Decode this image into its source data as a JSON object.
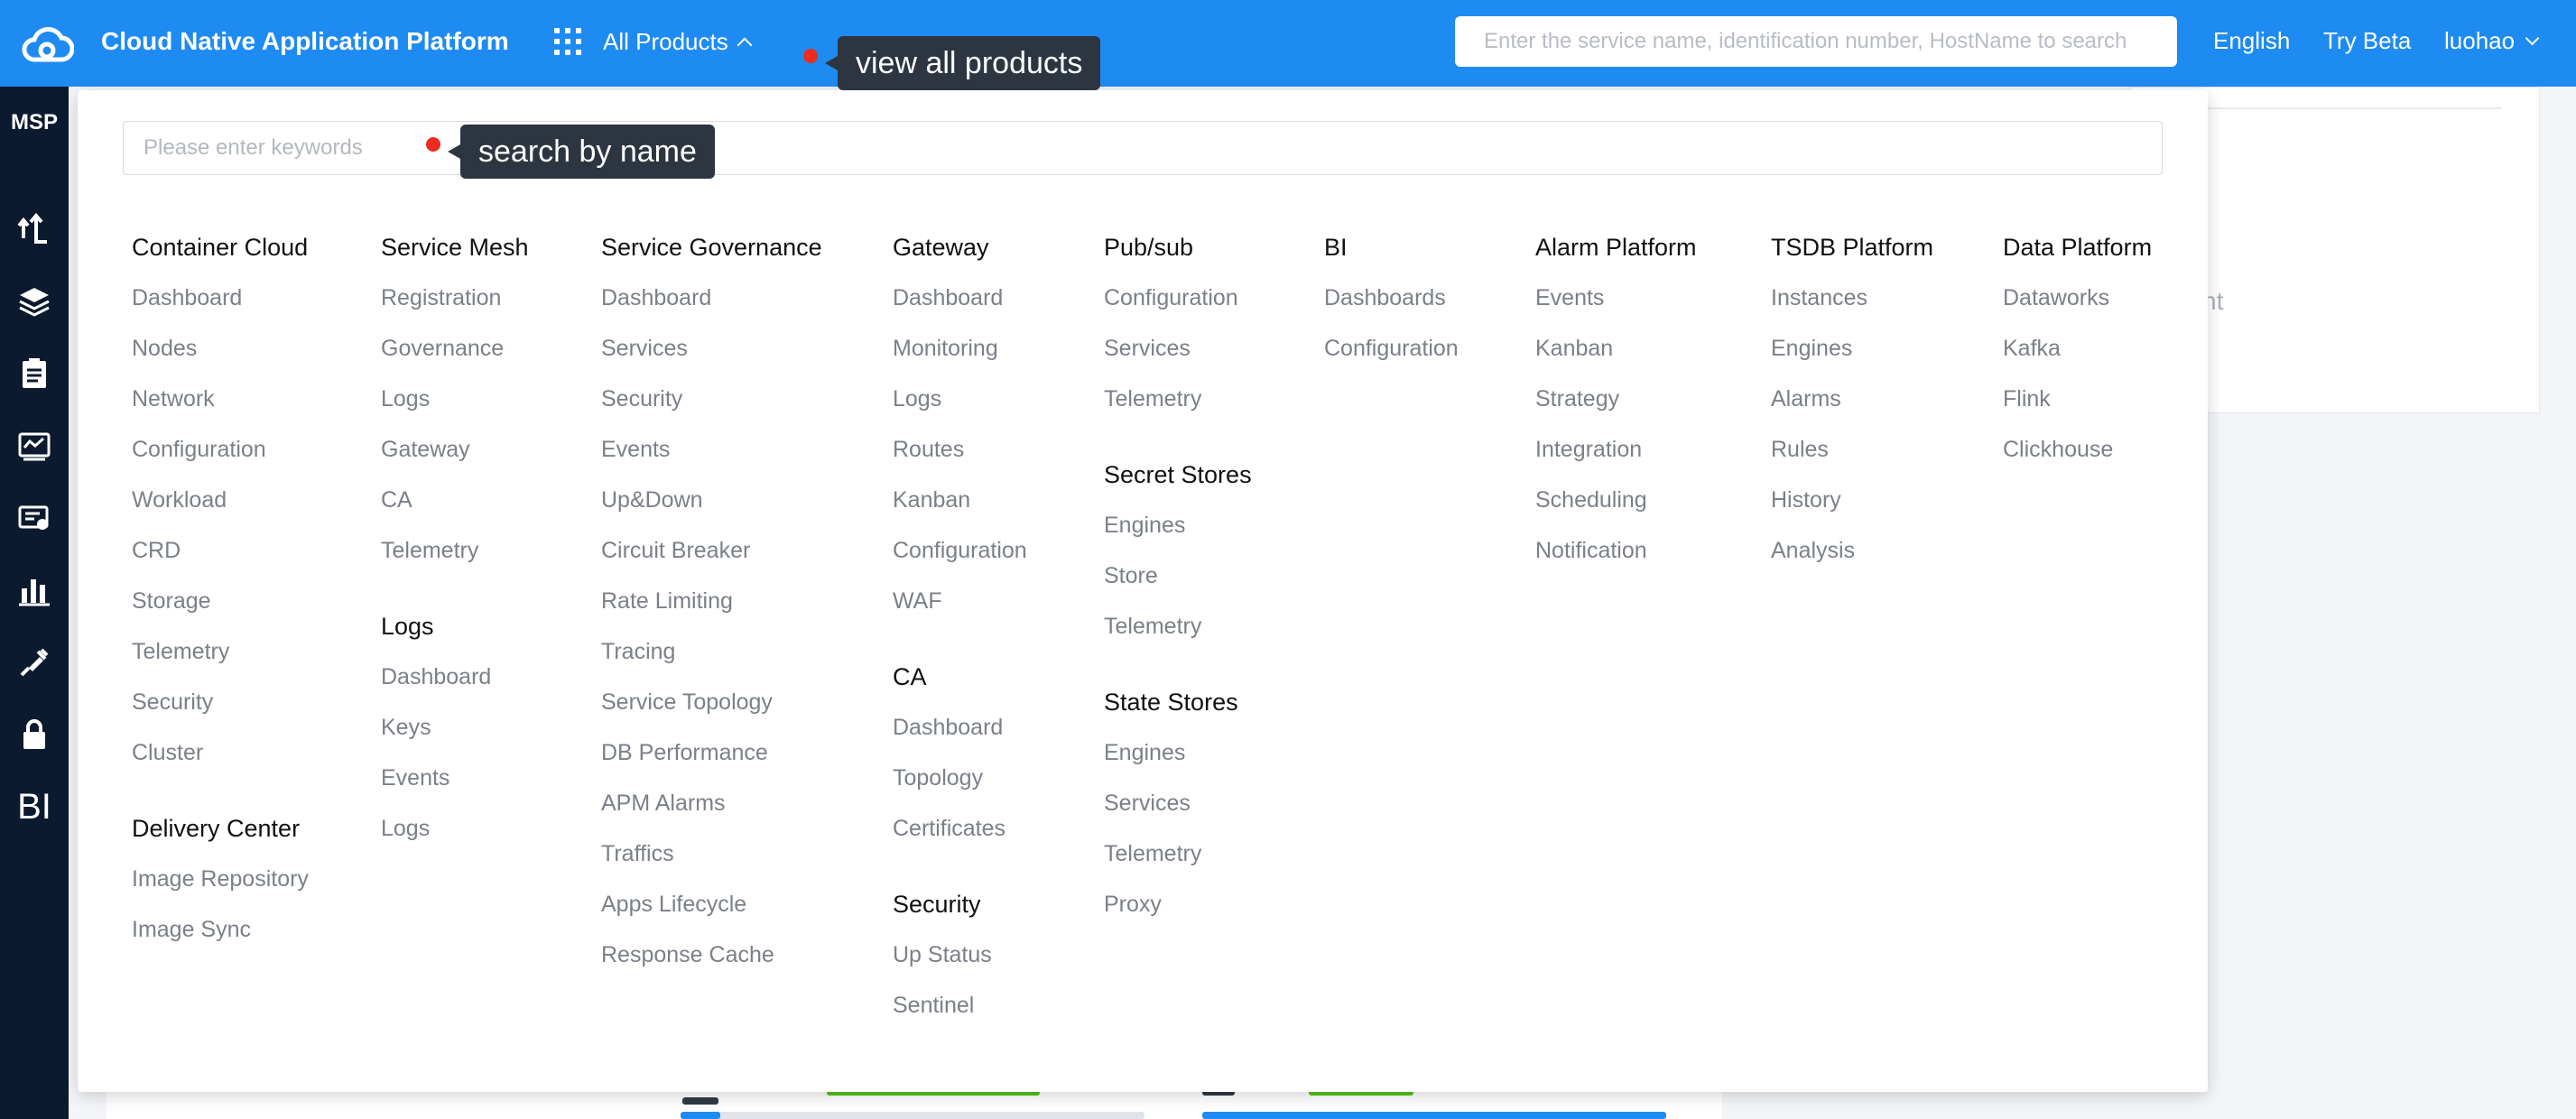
{
  "header": {
    "title": "Cloud Native Application Platform",
    "all_products_label": "All Products",
    "search_placeholder": "Enter the service name, identification number, HostName to search",
    "language": "English",
    "try_beta": "Try Beta",
    "user": "luohao",
    "accent_color": "#1e8bf2"
  },
  "sidebar": {
    "brand": "MSP",
    "bi_label": "BI",
    "icons": [
      "deploy-icon",
      "layers-icon",
      "clipboard-icon",
      "monitor-icon",
      "certificate-icon",
      "bar-chart-icon",
      "plug-icon",
      "lock-icon",
      "bi-icon"
    ]
  },
  "background": {
    "partial_text": "nt"
  },
  "panel": {
    "search_placeholder": "Please enter keywords",
    "columns": [
      {
        "groups": [
          {
            "title": "Container Cloud",
            "items": [
              "Dashboard",
              "Nodes",
              "Network",
              "Configuration",
              "Workload",
              "CRD",
              "Storage",
              "Telemetry",
              "Security",
              "Cluster"
            ]
          },
          {
            "title": "Delivery Center",
            "items": [
              "Image Repository",
              "Image Sync"
            ]
          }
        ]
      },
      {
        "groups": [
          {
            "title": "Service Mesh",
            "items": [
              "Registration",
              "Governance",
              "Logs",
              "Gateway",
              "CA",
              "Telemetry"
            ]
          },
          {
            "title": "Logs",
            "items": [
              "Dashboard",
              "Keys",
              "Events",
              "Logs"
            ]
          }
        ]
      },
      {
        "groups": [
          {
            "title": "Service Governance",
            "items": [
              "Dashboard",
              "Services",
              "Security",
              "Events",
              "Up&Down",
              "Circuit Breaker",
              "Rate Limiting",
              "Tracing",
              "Service Topology",
              "DB Performance",
              "APM Alarms",
              "Traffics",
              "Apps Lifecycle",
              "Response Cache"
            ]
          }
        ]
      },
      {
        "groups": [
          {
            "title": "Gateway",
            "items": [
              "Dashboard",
              "Monitoring",
              "Logs",
              "Routes",
              "Kanban",
              "Configuration",
              "WAF"
            ]
          },
          {
            "title": "CA",
            "items": [
              "Dashboard",
              "Topology",
              "Certificates"
            ]
          },
          {
            "title": "Security",
            "items": [
              "Up Status",
              "Sentinel"
            ]
          }
        ]
      },
      {
        "groups": [
          {
            "title": "Pub/sub",
            "items": [
              "Configuration",
              "Services",
              "Telemetry"
            ]
          },
          {
            "title": "Secret Stores",
            "items": [
              "Engines",
              "Store",
              "Telemetry"
            ]
          },
          {
            "title": "State Stores",
            "items": [
              "Engines",
              "Services",
              "Telemetry",
              "Proxy"
            ]
          }
        ]
      },
      {
        "groups": [
          {
            "title": "BI",
            "items": [
              "Dashboards",
              "Configuration"
            ]
          }
        ]
      },
      {
        "groups": [
          {
            "title": "Alarm Platform",
            "items": [
              "Events",
              "Kanban",
              "Strategy",
              "Integration",
              "Scheduling",
              "Notification"
            ]
          }
        ]
      },
      {
        "groups": [
          {
            "title": "TSDB Platform",
            "items": [
              "Instances",
              "Engines",
              "Alarms",
              "Rules",
              "History",
              "Analysis"
            ]
          }
        ]
      },
      {
        "groups": [
          {
            "title": "Data Platform",
            "items": [
              "Dataworks",
              "Kafka",
              "Flink",
              "Clickhouse"
            ]
          }
        ]
      }
    ]
  },
  "tooltips": {
    "all_products": "view all products",
    "search": "search by name",
    "marker_color": "#ee2b1f"
  }
}
